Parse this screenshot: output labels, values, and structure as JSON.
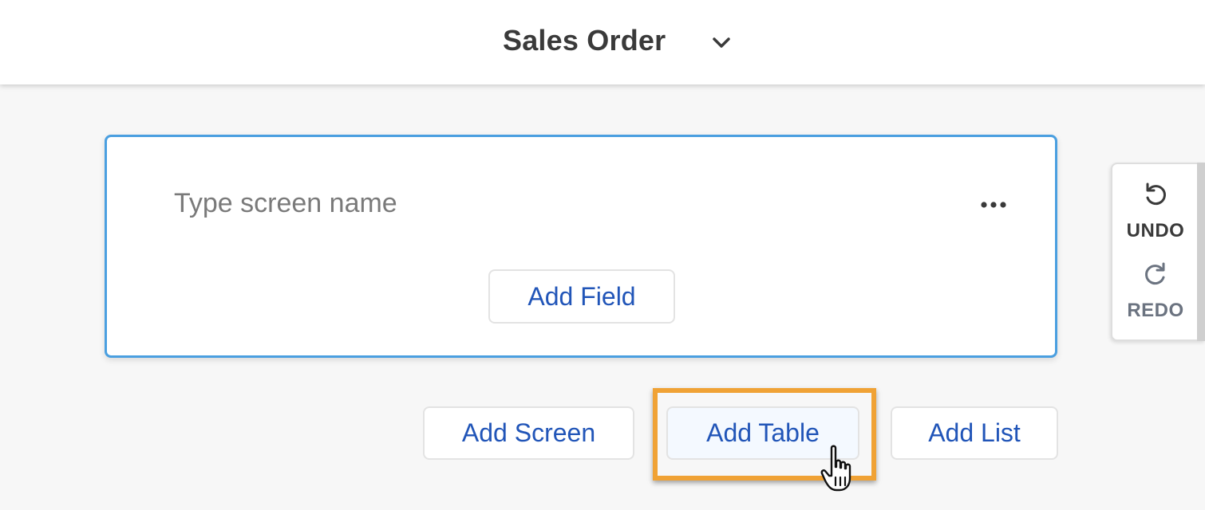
{
  "header": {
    "title": "Sales Order"
  },
  "screen_card": {
    "name_placeholder": "Type screen name",
    "name_value": "",
    "add_field_label": "Add Field",
    "more_icon": "more-horizontal-icon"
  },
  "actions": {
    "add_screen_label": "Add Screen",
    "add_table_label": "Add Table",
    "add_list_label": "Add List"
  },
  "history": {
    "undo_label": "UNDO",
    "redo_label": "REDO"
  },
  "colors": {
    "accent_blue": "#2155b8",
    "card_border": "#4a9fe0",
    "highlight": "#f0a235",
    "title_text": "#3a3a3a"
  }
}
